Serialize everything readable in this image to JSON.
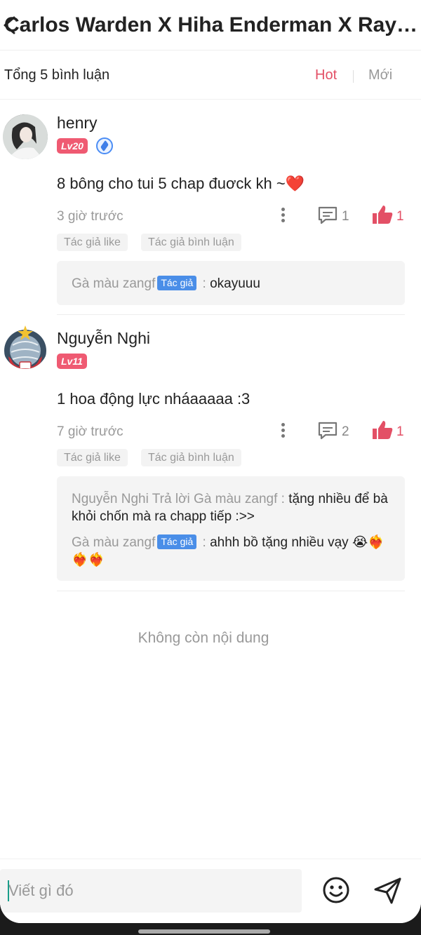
{
  "header": {
    "title": "Carlos Warden X Hiha Enderman X Ray En..."
  },
  "sort": {
    "total": "Tổng 5 bình luận",
    "hot": "Hot",
    "new": "Mới"
  },
  "comments": [
    {
      "user": "henry",
      "level": "Lv20",
      "text": "8 bông cho tui 5 chap đuơck kh ~❤️",
      "time": "3 giờ trước",
      "reply_count": "1",
      "like_count": "1",
      "tags": [
        "Tác giả like",
        "Tác giả bình luận"
      ],
      "replies": [
        {
          "from": "Gà màu zangf",
          "author_tag": "Tác giả",
          "sep": " :",
          "text": "okayuuu"
        }
      ]
    },
    {
      "user": "Nguyễn Nghi",
      "level": "Lv11",
      "text": "1 hoa động lực nháaaaaa :3",
      "time": "7 giờ trước",
      "reply_count": "2",
      "like_count": "1",
      "tags": [
        "Tác giả like",
        "Tác giả bình luận"
      ],
      "replies": [
        {
          "from": "Nguyễn Nghi Trả lời Gà màu zangf :",
          "text": "tặng nhiều để bà khỏi chốn mà ra chapp tiếp :>>"
        },
        {
          "from": "Gà màu zangf",
          "author_tag": "Tác giả",
          "sep": " :",
          "text": "ahhh bồ tặng nhiều vạy 😭❤️‍🔥❤️‍🔥❤️‍🔥"
        }
      ]
    }
  ],
  "footer_note": "Không còn nội dung",
  "composer": {
    "placeholder": "Viết gì đó"
  },
  "colors": {
    "accent": "#e35066",
    "author_tag": "#4a8ee8",
    "level_badge": "#ef5a72"
  },
  "icons": [
    "back-icon",
    "more-icon",
    "comment-icon",
    "like-icon",
    "emoji-icon",
    "send-icon"
  ]
}
